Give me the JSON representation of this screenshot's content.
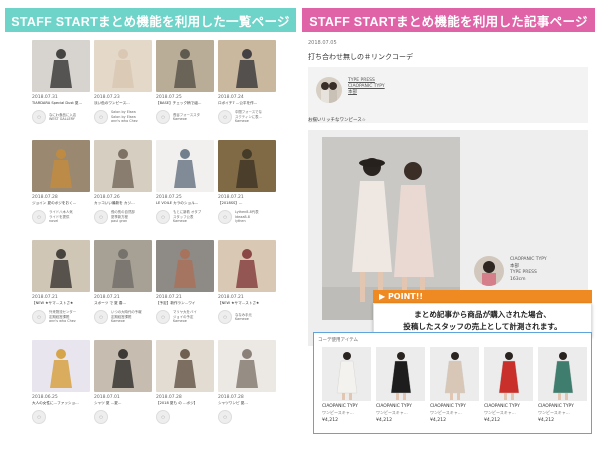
{
  "banners": {
    "left": "STAFF STARTまとめ機能を利用した一覧ページ",
    "right": "STAFF STARTまとめ機能を利用した記事ページ"
  },
  "grid": [
    {
      "date": "2018.07.31",
      "title": "TIARDARA Special Dust 夏…",
      "shop": [
        "なにわ食品に入店",
        "WEST GALLERY"
      ]
    },
    {
      "date": "2018.07.23",
      "title": "淡い色のワンピース…",
      "shop": [
        "Salon by Elsea",
        "Salon by Elsea",
        "ann's who Chez"
      ]
    },
    {
      "date": "2018.07.25",
      "title": "【BASE】チェック柄で組…",
      "shop": [
        "長谷フォーススタ",
        "Kameoe"
      ]
    },
    {
      "date": "2018.07.24",
      "title": "ロボイチ7 …公平を作…",
      "shop": [
        "中間フォースでな",
        "スクティンに表…",
        "Kameoe"
      ]
    },
    {
      "date": "2018.07.28",
      "title": "ジョイン 夏のポジをおく…",
      "shop": [
        "ライド八木人気",
        "ライドを提供",
        "novel"
      ]
    },
    {
      "date": "2018.07.26",
      "title": "カッコいい最新を カジ…",
      "shop": [
        "飛の別の自然部",
        "夏季新方程",
        "paul gran"
      ]
    },
    {
      "date": "2018.07.25",
      "title": "LE VOILE カラのショル…",
      "shop": [
        "もとに新着 オタブ",
        "スタッフ公表",
        "Kameoe"
      ]
    },
    {
      "date": "2018.07.21",
      "title": "【2018SS】…",
      "shop": [
        "Lythen8-8代表",
        "Ideaa8-8",
        "lythen"
      ]
    },
    {
      "date": "2018.07.21",
      "title": "【NEW ★サマ…ストさ★",
      "shop": [
        "外来物流センター",
        "定期経営課題",
        "ann's who Chez"
      ]
    },
    {
      "date": "2018.07.21",
      "title": "スポーツ で 夏 春…",
      "shop": [
        "いつの大時代の予報",
        "定期経営課題",
        "Kameoe"
      ]
    },
    {
      "date": "2018.07.21",
      "title": "【予定】新作ラン…ワイ",
      "shop": [
        "マリヤ大をバイ",
        "ジョイの予定",
        "Kameoe"
      ]
    },
    {
      "date": "2018.07.21",
      "title": "【NEW ★サマ…ストさ★",
      "shop": [
        "ななみ手元",
        "Kameoe"
      ]
    },
    {
      "date": "2018.06.25",
      "title": "大人の女性に…ファッショ…",
      "shop": [
        "",
        ""
      ]
    },
    {
      "date": "2018.07.01",
      "title": "シャツ 夏 …夏…",
      "shop": [
        "",
        ""
      ]
    },
    {
      "date": "2018.07.28",
      "title": "【2018 夏も の …ポジ】",
      "shop": [
        "",
        ""
      ]
    },
    {
      "date": "2018.07.28",
      "title": "シャツワンピ 夏…",
      "shop": [
        "",
        ""
      ]
    }
  ],
  "panel": {
    "date": "2018.07.05",
    "title": "打ち合わせ無しの＃リンクコーデ",
    "author_links": [
      "TYPE PRESS",
      "CIAOPANIC TYPY",
      "本部"
    ],
    "intro": "お揃いリッチなワンピース☆",
    "staff": [
      "CIAOPANIC TYPY",
      "本部",
      "TYPE PRESS",
      "163cm"
    ],
    "point_label": "▶ POINT!!",
    "point_lines": [
      "まとめ記事から商品が購入された場合、",
      "投稿したスタッフの売上として計測されます。"
    ],
    "items_label": "コーデ使用アイテム",
    "items": [
      {
        "brand": "CIAOPANIC TYPY",
        "name": "ワンピースキャ…",
        "price": "¥4,212"
      },
      {
        "brand": "CIAOPANIC TYPY",
        "name": "ワンピースキャ…",
        "price": "¥4,212"
      },
      {
        "brand": "CIAOPANIC TYPY",
        "name": "ワンピースキャ…",
        "price": "¥4,212"
      },
      {
        "brand": "CIAOPANIC TYPY",
        "name": "ワンピースキャ…",
        "price": "¥4,212"
      },
      {
        "brand": "CIAOPANIC TYPY",
        "name": "ワンピースキャ…",
        "price": "¥4,212"
      }
    ]
  },
  "colors": {
    "left_banner": "#6ed3c8",
    "right_banner": "#e063a8",
    "point": "#ef8a23",
    "items_border": "#5fa4dd"
  },
  "thumb_palettes": [
    [
      "#d7d4cf",
      "#2a2a2a"
    ],
    [
      "#e4d8c8",
      "#d8c6b0"
    ],
    [
      "#b9ad98",
      "#4f4b43"
    ],
    [
      "#c9b79e",
      "#2b2d33"
    ],
    [
      "#9a8870",
      "#c58c3a"
    ],
    [
      "#d6cec1",
      "#6e6153"
    ],
    [
      "#f1f0ee",
      "#5b6a7b"
    ],
    [
      "#7f6a45",
      "#3a3223"
    ],
    [
      "#cfc6b6",
      "#2f2b28"
    ],
    [
      "#a7a094",
      "#6d6b66"
    ],
    [
      "#8e8a85",
      "#ad6e56"
    ],
    [
      "#d9c9b4",
      "#7c2f32"
    ],
    [
      "#e8e5ef",
      "#d49a2c"
    ],
    [
      "#c6bdb0",
      "#242321"
    ],
    [
      "#e2dcd2",
      "#5a4a3b"
    ],
    [
      "#ece8e4",
      "#7a6f66"
    ]
  ],
  "item_colors": [
    "#f4f2ee",
    "#1d1d1d",
    "#d8c6b6",
    "#c9302c",
    "#3f7d6e"
  ]
}
